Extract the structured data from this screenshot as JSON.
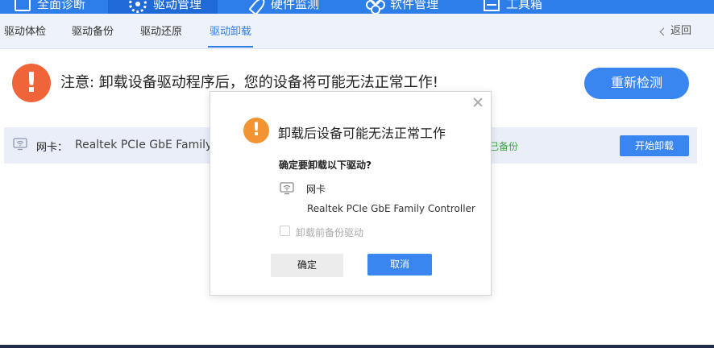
{
  "topnav": {
    "items": [
      {
        "label": "全面诊断",
        "icon": "monitor-icon"
      },
      {
        "label": "驱动管理",
        "icon": "gear-icon"
      },
      {
        "label": "硬件监测",
        "icon": "rocket-icon"
      },
      {
        "label": "软件管理",
        "icon": "flower-icon"
      },
      {
        "label": "工具箱",
        "icon": "toolbox-icon"
      }
    ],
    "active_index": 1
  },
  "subnav": {
    "tabs": [
      {
        "label": "驱动体检"
      },
      {
        "label": "驱动备份"
      },
      {
        "label": "驱动还原"
      },
      {
        "label": "驱动卸载"
      }
    ],
    "active_index": 3,
    "back_label": "返回"
  },
  "notice": {
    "icon_text": "!",
    "text": "注意: 卸载设备驱动程序后，您的设备将可能无法正常工作!",
    "redetect_label": "重新检测"
  },
  "driver_row": {
    "label": "网卡：",
    "name": "Realtek PCIe GbE Family Controller",
    "status": "已备份",
    "button_label": "开始卸载"
  },
  "dialog": {
    "icon_text": "!",
    "title": "卸载后设备可能无法正常工作",
    "question": "确定要卸载以下驱动?",
    "device_label": "网卡",
    "device_name": "Realtek PCIe GbE Family Controller",
    "backup_checkbox_label": "卸载前备份驱动",
    "backup_checked": false,
    "ok_label": "确定",
    "cancel_label": "取消"
  },
  "colors": {
    "primary": "#3a86f0",
    "nav_bg": "#2d7ee8",
    "warning_red": "#f0643a",
    "warning_orange": "#f39432",
    "success_green": "#3aa83a"
  }
}
